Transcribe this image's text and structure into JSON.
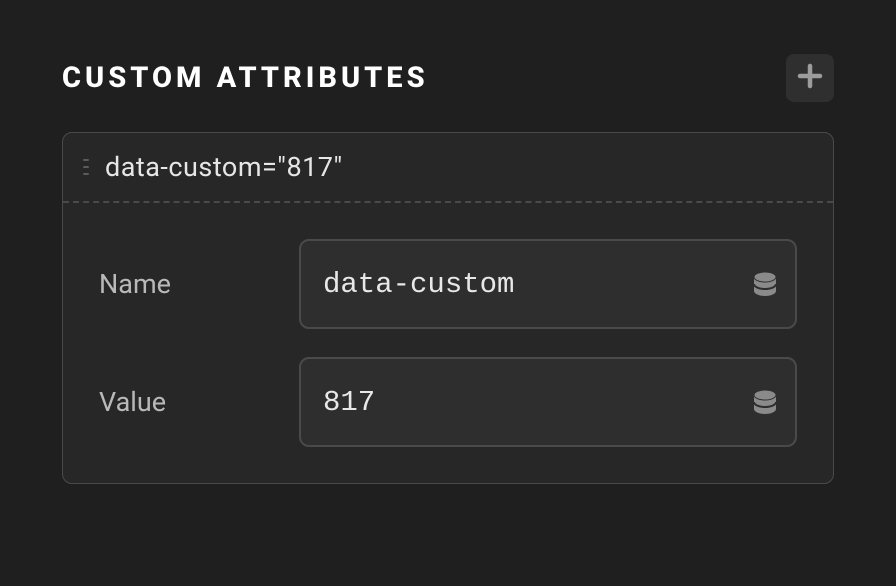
{
  "panel": {
    "title": "CUSTOM ATTRIBUTES"
  },
  "attribute": {
    "summary": "data-custom=\"817\"",
    "fields": {
      "name_label": "Name",
      "name_value": "data-custom",
      "value_label": "Value",
      "value_value": "817"
    }
  },
  "icons": {
    "add": "plus-icon",
    "drag": "drag-handle-icon",
    "database": "database-icon"
  }
}
